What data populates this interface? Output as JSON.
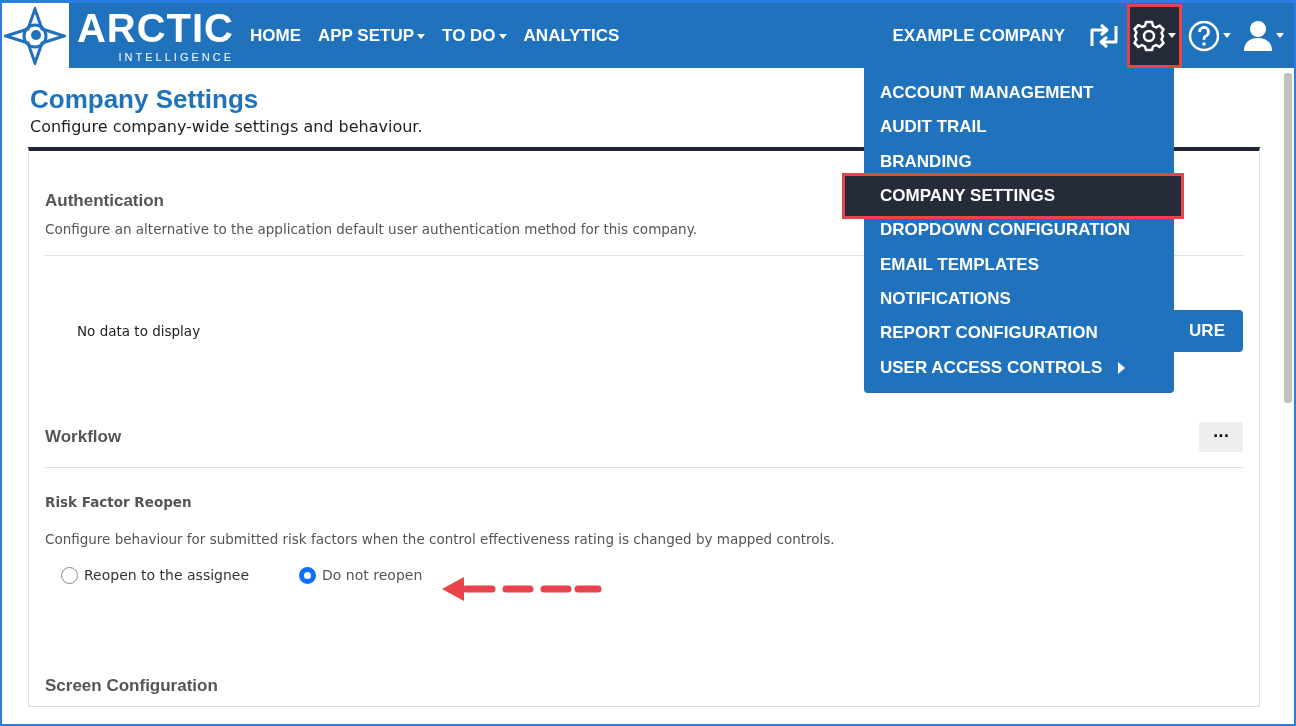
{
  "navbar": {
    "logo": {
      "word": "ARCTIC",
      "tagline": "INTELLIGENCE"
    },
    "links": [
      {
        "label": "HOME",
        "dropdown": false
      },
      {
        "label": "APP SETUP",
        "dropdown": true
      },
      {
        "label": "TO DO",
        "dropdown": true
      },
      {
        "label": "ANALYTICS",
        "dropdown": false
      }
    ],
    "company": "EXAMPLE COMPANY",
    "icons": [
      {
        "kind": "switch",
        "dropdown": false,
        "selected": false
      },
      {
        "kind": "gear",
        "dropdown": true,
        "selected": true
      },
      {
        "kind": "help",
        "dropdown": true,
        "selected": false
      },
      {
        "kind": "user",
        "dropdown": true,
        "selected": false
      }
    ]
  },
  "settings_menu": [
    {
      "label": "ACCOUNT MANAGEMENT",
      "selected": false,
      "submenu": false
    },
    {
      "label": "AUDIT TRAIL",
      "selected": false,
      "submenu": false
    },
    {
      "label": "BRANDING",
      "selected": false,
      "submenu": false
    },
    {
      "label": "COMPANY SETTINGS",
      "selected": true,
      "submenu": false
    },
    {
      "label": "DROPDOWN CONFIGURATION",
      "selected": false,
      "submenu": false
    },
    {
      "label": "EMAIL TEMPLATES",
      "selected": false,
      "submenu": false
    },
    {
      "label": "NOTIFICATIONS",
      "selected": false,
      "submenu": false
    },
    {
      "label": "REPORT CONFIGURATION",
      "selected": false,
      "submenu": false
    },
    {
      "label": "USER ACCESS CONTROLS",
      "selected": false,
      "submenu": true
    }
  ],
  "page": {
    "title": "Company Settings",
    "subtitle": "Configure company-wide settings and behaviour."
  },
  "authentication": {
    "title": "Authentication",
    "description": "Configure an alternative to the application default user authentication method for this company.",
    "empty": "No data to display",
    "button": "URE"
  },
  "workflow": {
    "title": "Workflow",
    "more": "···",
    "setting": {
      "title": "Risk Factor Reopen",
      "description": "Configure behaviour for submitted risk factors when the control effectiveness rating is changed by mapped controls.",
      "options": [
        {
          "label": "Reopen to the assignee",
          "selected": false
        },
        {
          "label": "Do not reopen",
          "selected": true
        }
      ]
    }
  },
  "next_section": {
    "title": "Screen Configuration"
  }
}
